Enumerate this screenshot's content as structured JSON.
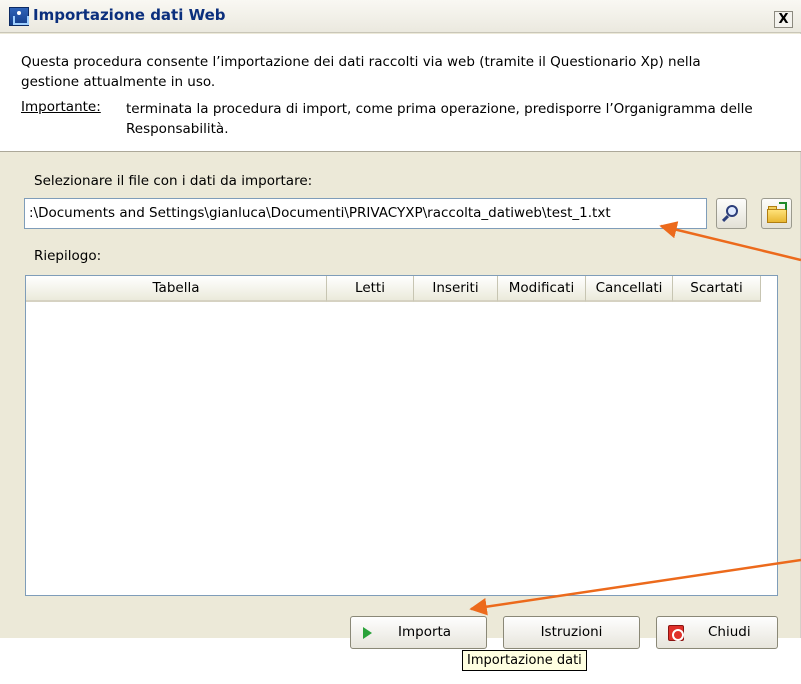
{
  "window": {
    "title": "Importazione dati Web",
    "close_label": "X",
    "app_icon": "app-import-icon"
  },
  "info": {
    "line1": "Questa procedura consente l’importazione dei dati raccolti via web (tramite il Questionario Xp) nella",
    "line2": "gestione attualmente in uso.",
    "important_label": "Importante:",
    "important_text": "terminata la procedura di import, come prima operazione, predisporre l’Organigramma delle Responsabilità."
  },
  "file": {
    "label": "Selezionare il file con i dati da importare:",
    "path": ":\\Documents and Settings\\gianluca\\Documenti\\PRIVACYXP\\raccolta_datiweb\\test_1.txt",
    "browse_icon": "search-icon",
    "open_icon": "open-folder-icon"
  },
  "summary": {
    "label": "Riepilogo:",
    "columns": [
      "Tabella",
      "Letti",
      "Inseriti",
      "Modificati",
      "Cancellati",
      "Scartati"
    ],
    "rows": []
  },
  "buttons": {
    "import": "Importa",
    "instructions": "Istruzioni",
    "close": "Chiudi"
  },
  "tooltip": "Importazione dati",
  "colors": {
    "annotation_arrow": "#ec6a1c",
    "title_text": "#0b2f7d",
    "window_bg": "#ece9d8"
  }
}
